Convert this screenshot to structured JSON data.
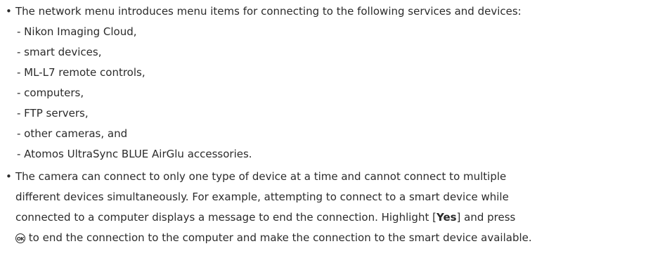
{
  "bullets": {
    "b1": {
      "text": "The network menu introduces menu items for connecting to the following services and devices:",
      "sub_items": [
        "- Nikon Imaging Cloud,",
        "- smart devices,",
        "- ML-L7 remote controls,",
        "- computers,",
        "- FTP servers,",
        "- other cameras, and",
        "- Atomos UltraSync BLUE AirGlu accessories."
      ]
    },
    "b2": {
      "line1": "The camera can connect to only one type of device at a time and cannot connect to multiple",
      "line2": "different devices simultaneously. For example, attempting to connect to a smart device while",
      "line3_pre": "connected to a computer displays a message to end the connection. Highlight [",
      "line3_bold": "Yes",
      "line3_post": "] and press",
      "line4_icon": "OK",
      "line4": " to end the connection to the computer and make the connection to the smart device available."
    }
  }
}
